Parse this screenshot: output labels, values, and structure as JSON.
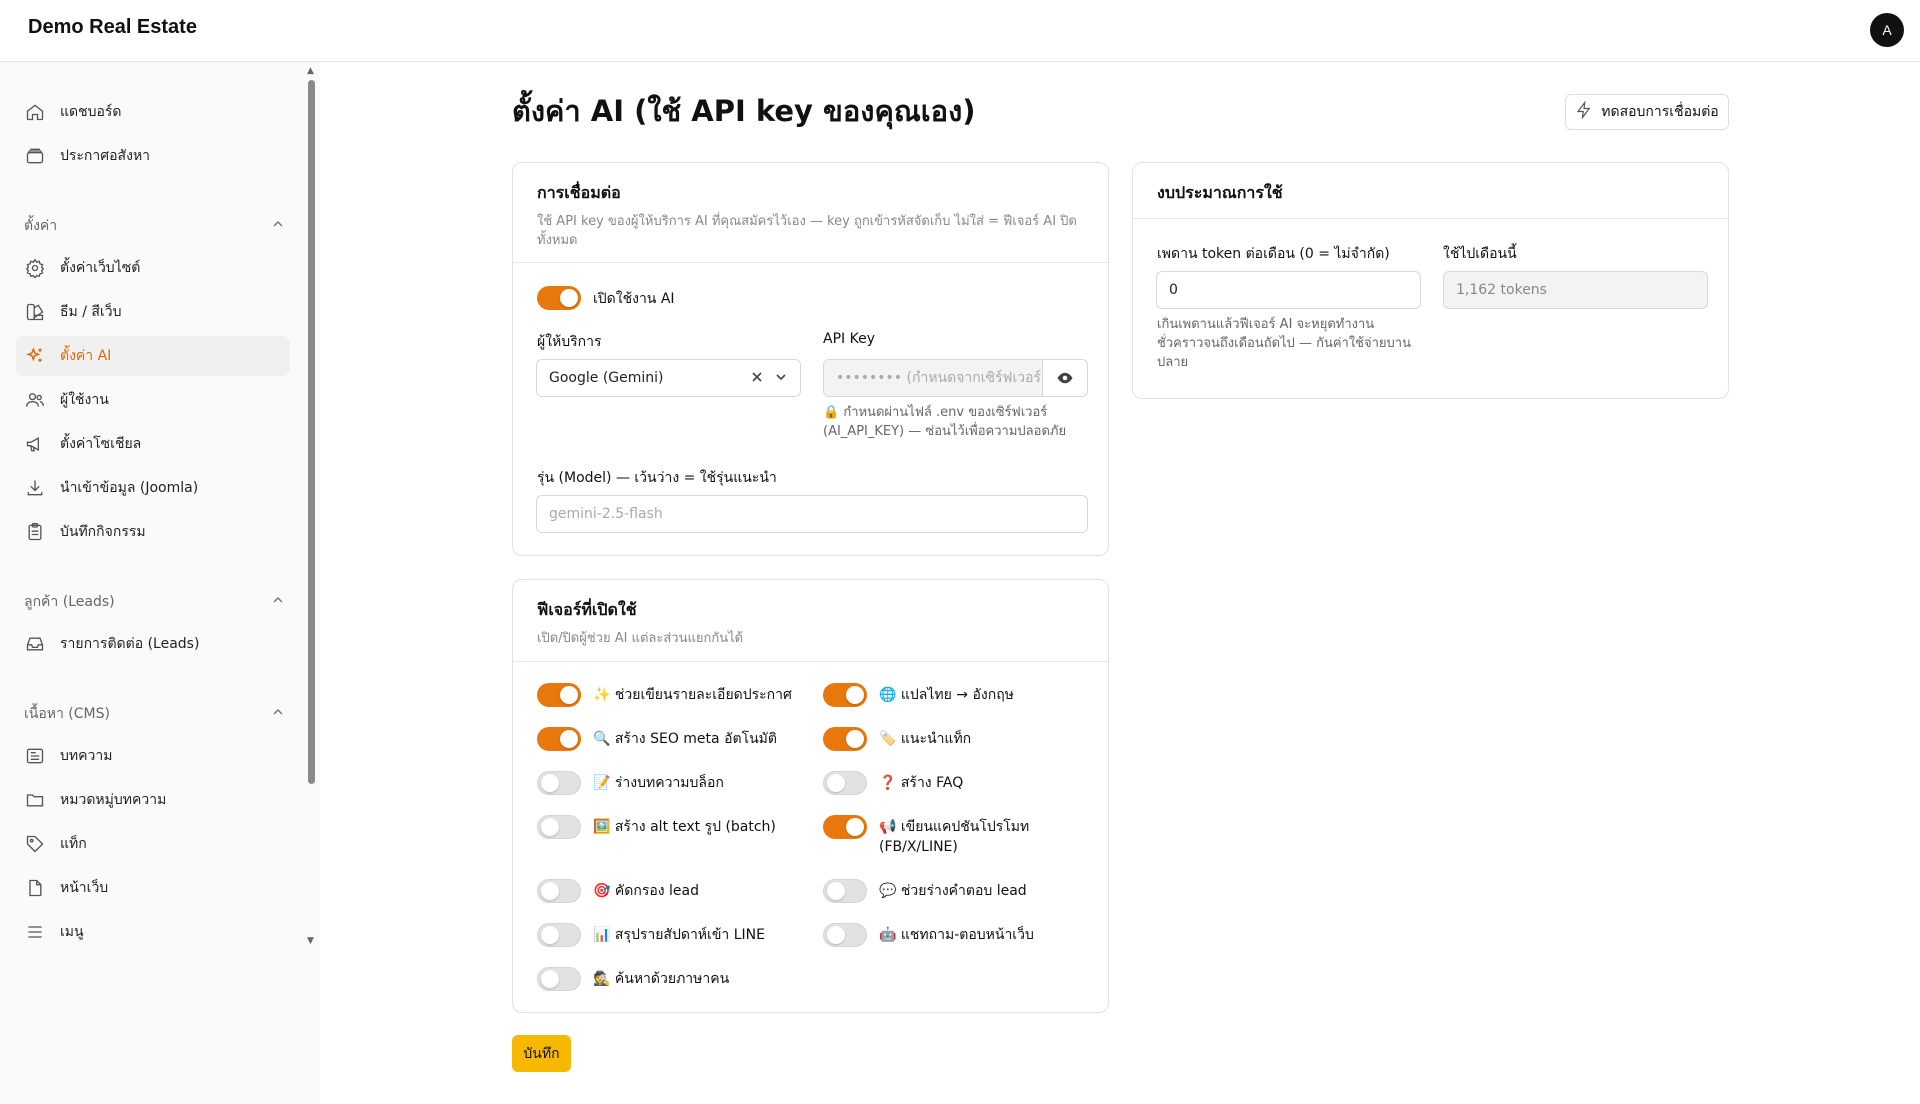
{
  "app": {
    "brand": "Demo Real Estate",
    "avatar_initial": "A"
  },
  "sidebar": {
    "top_items": [
      {
        "label": "แดชบอร์ด",
        "icon": "home-icon"
      },
      {
        "label": "ประกาศอสังหา",
        "icon": "box-icon"
      }
    ],
    "groups": [
      {
        "label": "ตั้งค่า",
        "items": [
          {
            "label": "ตั้งค่าเว็บไซต์",
            "icon": "gear-icon"
          },
          {
            "label": "ธีม / สีเว็บ",
            "icon": "palette-icon"
          },
          {
            "label": "ตั้งค่า AI",
            "icon": "sparkles-icon",
            "active": true
          },
          {
            "label": "ผู้ใช้งาน",
            "icon": "users-icon"
          },
          {
            "label": "ตั้งค่าโซเชียล",
            "icon": "megaphone-icon"
          },
          {
            "label": "นำเข้าข้อมูล (Joomla)",
            "icon": "download-icon"
          },
          {
            "label": "บันทึกกิจกรรม",
            "icon": "clipboard-icon"
          }
        ]
      },
      {
        "label": "ลูกค้า (Leads)",
        "items": [
          {
            "label": "รายการติดต่อ (Leads)",
            "icon": "inbox-icon"
          }
        ]
      },
      {
        "label": "เนื้อหา (CMS)",
        "items": [
          {
            "label": "บทความ",
            "icon": "newspaper-icon"
          },
          {
            "label": "หมวดหมู่บทความ",
            "icon": "folder-icon"
          },
          {
            "label": "แท็ก",
            "icon": "tag-icon"
          },
          {
            "label": "หน้าเว็บ",
            "icon": "file-icon"
          },
          {
            "label": "เมนู",
            "icon": "menu-icon"
          }
        ]
      }
    ]
  },
  "page": {
    "title": "ตั้งค่า AI (ใช้ API key ของคุณเอง)",
    "test_button": "ทดสอบการเชื่อมต่อ"
  },
  "connection": {
    "title": "การเชื่อมต่อ",
    "subtitle": "ใช้ API key ของผู้ให้บริการ AI ที่คุณสมัครไว้เอง — key ถูกเข้ารหัสจัดเก็บ ไม่ใส่ = ฟีเจอร์ AI ปิดทั้งหมด",
    "enable_label": "เปิดใช้งาน AI",
    "enable_on": true,
    "provider_label": "ผู้ให้บริการ",
    "provider_value": "Google (Gemini)",
    "api_key_label": "API Key",
    "api_key_placeholder": "•••••••• (กำหนดจากเซิร์ฟเวอร์)",
    "api_key_hint": "🔒 กำหนดผ่านไฟล์ .env ของเซิร์ฟเวอร์ (AI_API_KEY) — ซ่อนไว้เพื่อความปลอดภัย",
    "model_label": "รุ่น (Model) — เว้นว่าง = ใช้รุ่นแนะนำ",
    "model_placeholder": "gemini-2.5-flash"
  },
  "features": {
    "title": "ฟีเจอร์ที่เปิดใช้",
    "subtitle": "เปิด/ปิดผู้ช่วย AI แต่ละส่วนแยกกันได้",
    "items": [
      {
        "label": "✨ ช่วยเขียนรายละเอียดประกาศ",
        "on": true
      },
      {
        "label": "🌐 แปลไทย → อังกฤษ",
        "on": true
      },
      {
        "label": "🔍 สร้าง SEO meta อัตโนมัติ",
        "on": true
      },
      {
        "label": "🏷️ แนะนำแท็ก",
        "on": true
      },
      {
        "label": "📝 ร่างบทความบล็อก",
        "on": false
      },
      {
        "label": "❓ สร้าง FAQ",
        "on": false
      },
      {
        "label": "🖼️ สร้าง alt text รูป (batch)",
        "on": false
      },
      {
        "label": "📢 เขียนแคปชันโปรโมท (FB/X/LINE)",
        "on": true
      },
      {
        "label": "🎯 คัดกรอง lead",
        "on": false
      },
      {
        "label": "💬 ช่วยร่างคำตอบ lead",
        "on": false
      },
      {
        "label": "📊 สรุปรายสัปดาห์เข้า LINE",
        "on": false
      },
      {
        "label": "🤖 แชทถาม-ตอบหน้าเว็บ",
        "on": false
      },
      {
        "label": "🕵️ ค้นหาด้วยภาษาคน",
        "on": false
      }
    ]
  },
  "budget": {
    "title": "งบประมาณการใช้",
    "limit_label": "เพดาน token ต่อเดือน (0 = ไม่จำกัด)",
    "limit_value": "0",
    "limit_hint": "เกินเพดานแล้วฟีเจอร์ AI จะหยุดทำงานชั่วคราวจนถึงเดือนถัดไป — กันค่าใช้จ่ายบานปลาย",
    "used_label": "ใช้ไปเดือนนี้",
    "used_value": "1,162 tokens"
  },
  "save_button": "บันทึก",
  "colors": {
    "accent": "#e8780c",
    "save": "#f6b800"
  }
}
